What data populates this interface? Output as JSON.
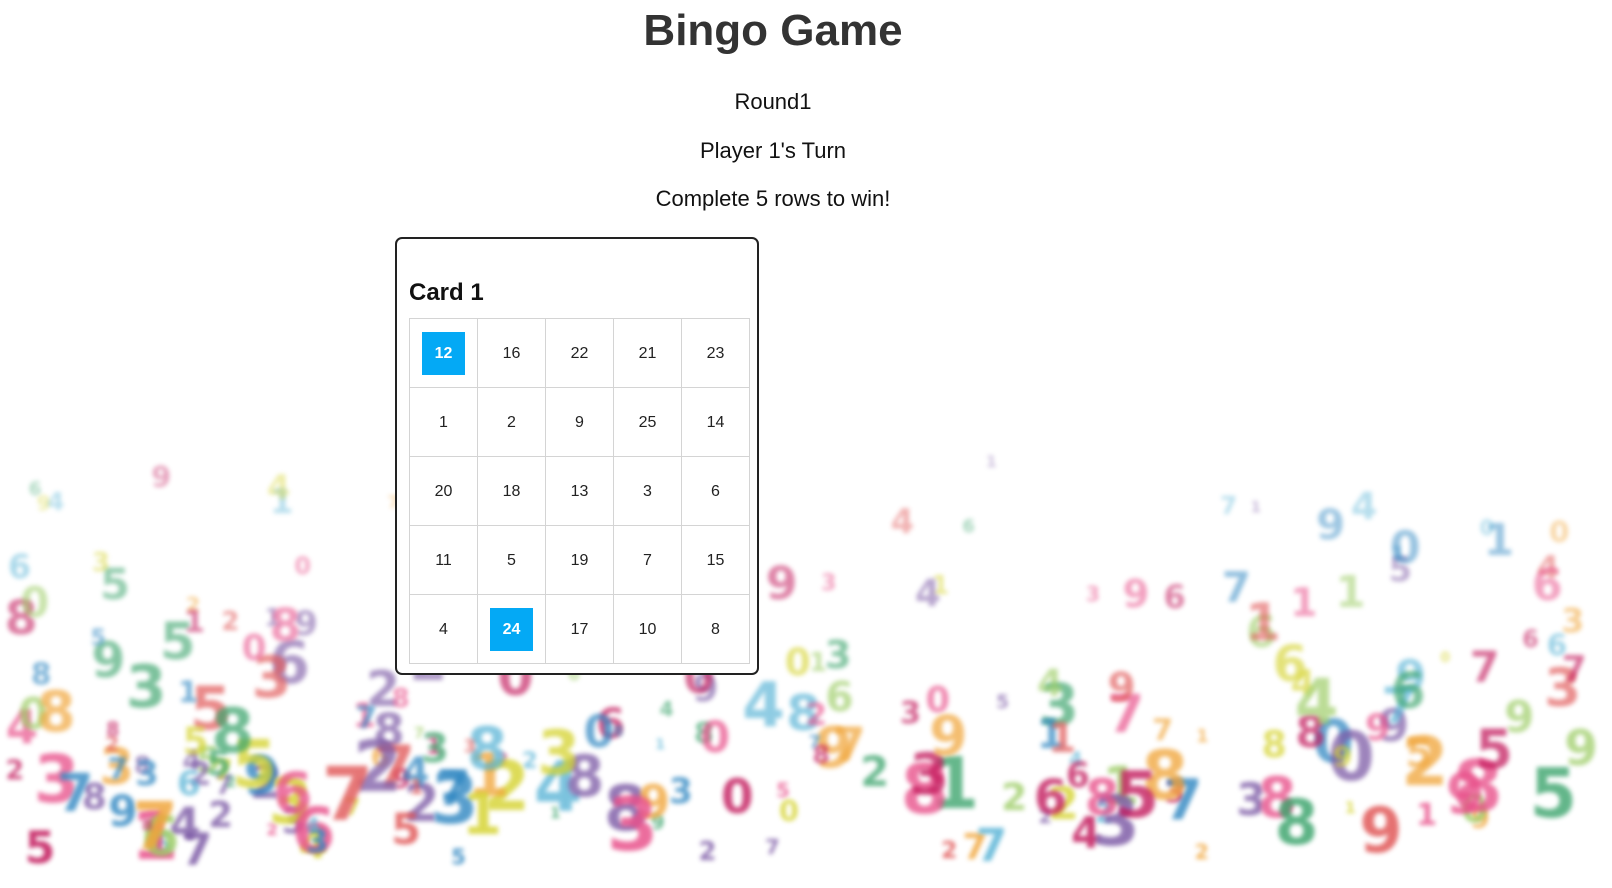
{
  "title": "Bingo Game",
  "round_text": "Round1",
  "turn_text": "Player 1's Turn",
  "goal_text": "Complete 5 rows to win!",
  "card": {
    "title": "Card 1",
    "rows": [
      [
        {
          "n": "12",
          "marked": true
        },
        {
          "n": "16",
          "marked": false
        },
        {
          "n": "22",
          "marked": false
        },
        {
          "n": "21",
          "marked": false
        },
        {
          "n": "23",
          "marked": false
        }
      ],
      [
        {
          "n": "1",
          "marked": false
        },
        {
          "n": "2",
          "marked": false
        },
        {
          "n": "9",
          "marked": false
        },
        {
          "n": "25",
          "marked": false
        },
        {
          "n": "14",
          "marked": false
        }
      ],
      [
        {
          "n": "20",
          "marked": false
        },
        {
          "n": "18",
          "marked": false
        },
        {
          "n": "13",
          "marked": false
        },
        {
          "n": "3",
          "marked": false
        },
        {
          "n": "6",
          "marked": false
        }
      ],
      [
        {
          "n": "11",
          "marked": false
        },
        {
          "n": "5",
          "marked": false
        },
        {
          "n": "19",
          "marked": false
        },
        {
          "n": "7",
          "marked": false
        },
        {
          "n": "15",
          "marked": false
        }
      ],
      [
        {
          "n": "4",
          "marked": false
        },
        {
          "n": "24",
          "marked": true
        },
        {
          "n": "17",
          "marked": false
        },
        {
          "n": "10",
          "marked": false
        },
        {
          "n": "8",
          "marked": false
        }
      ]
    ]
  },
  "colors": {
    "marked": "#04a9f5",
    "title": "#333333",
    "border": "#222222",
    "grid_line": "#d4d4d4"
  },
  "background_image": "blurred-colorful-numbers-pattern"
}
